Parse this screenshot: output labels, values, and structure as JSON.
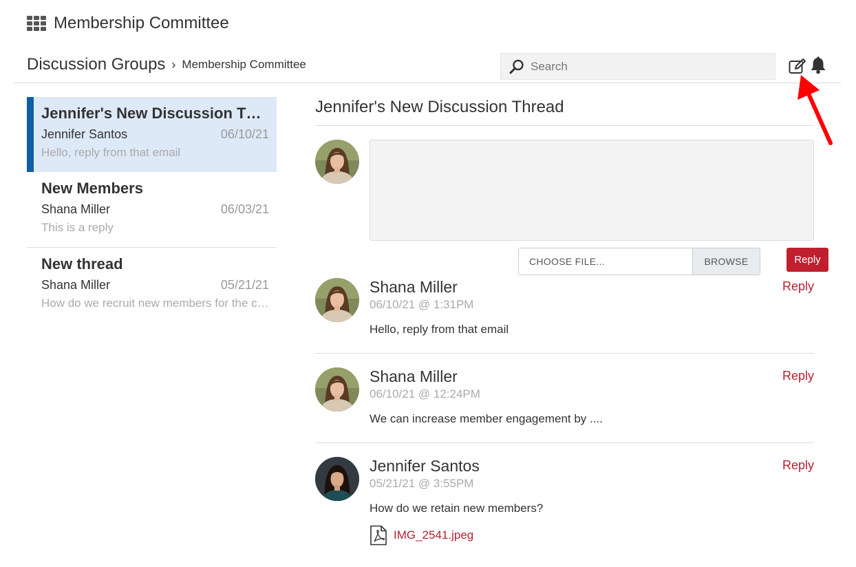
{
  "app": {
    "title": "Membership Committee",
    "menu_icon": "grid-icon"
  },
  "breadcrumb": {
    "parent": "Discussion Groups",
    "separator": "›",
    "current": "Membership Committee"
  },
  "search": {
    "placeholder": "Search",
    "value": "",
    "icon": "search-icon"
  },
  "toolbar": {
    "new_post_icon": "edit-icon",
    "notifications_icon": "bell-icon"
  },
  "annotation": {
    "icon": "red-arrow",
    "color": "#ff0000"
  },
  "threads": [
    {
      "title": "Jennifer's New Discussion Thread",
      "author": "Jennifer Santos",
      "date": "06/10/21",
      "preview": "Hello, reply from that email",
      "active": true
    },
    {
      "title": "New Members",
      "author": "Shana Miller",
      "date": "06/03/21",
      "preview": "This is a reply",
      "active": false
    },
    {
      "title": "New thread",
      "author": "Shana Miller",
      "date": "05/21/21",
      "preview": "How do we recruit new members for the committee?",
      "active": false
    }
  ],
  "main": {
    "title": "Jennifer's New Discussion Thread",
    "compose": {
      "placeholder": "",
      "value": ""
    },
    "file": {
      "label": "CHOOSE FILE...",
      "browse": "BROWSE"
    },
    "reply_button": "Reply"
  },
  "posts": [
    {
      "author": "Shana Miller",
      "timestamp": "06/10/21 @ 1:31PM",
      "body": "Hello, reply from that email",
      "reply": "Reply"
    },
    {
      "author": "Shana Miller",
      "timestamp": "06/10/21 @ 12:24PM",
      "body": "We can increase member engagement by ....",
      "reply": "Reply"
    },
    {
      "author": "Jennifer Santos",
      "timestamp": "05/21/21 @ 3:55PM",
      "body": "How do we retain new members?",
      "reply": "Reply",
      "attachment": "IMG_2541.jpeg"
    }
  ],
  "colors": {
    "accent": "#c0202e",
    "link": "#b52130",
    "active_bar": "#0d5fa6",
    "active_bg": "#dde9f7"
  }
}
